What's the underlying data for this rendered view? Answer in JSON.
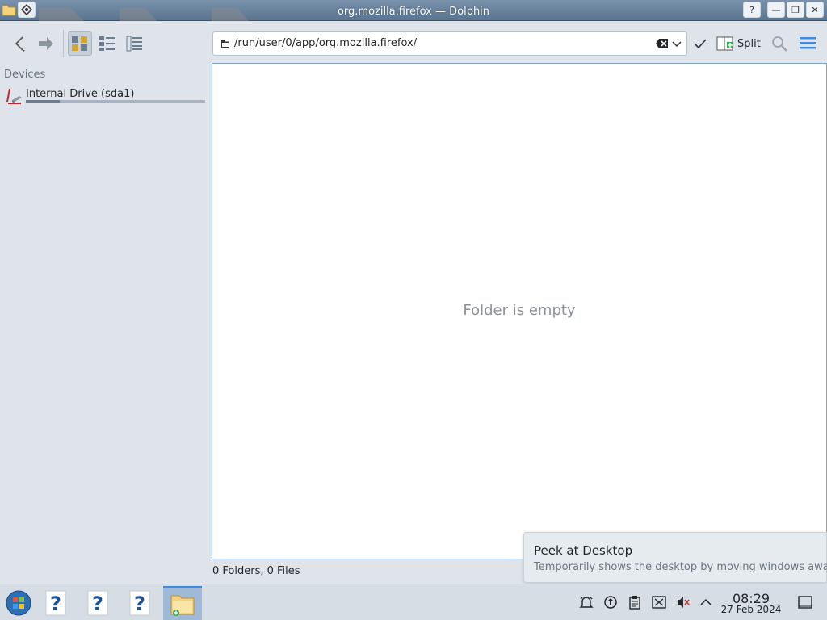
{
  "window": {
    "title": "org.mozilla.firefox — Dolphin",
    "buttons": {
      "help": "?",
      "minimize": "—",
      "maximize": "❐",
      "close": "✕"
    }
  },
  "toolbar": {
    "back_icon": "chevron-left-icon",
    "forward_icon": "arrow-right-icon",
    "view_modes": [
      "icons-view",
      "compact-view",
      "details-view"
    ],
    "active_view": "icons-view",
    "location_path": "/run/user/0/app/org.mozilla.firefox/",
    "split_label": "Split"
  },
  "places": {
    "section_label": "Devices",
    "items": [
      {
        "label": "Internal Drive (sda1)",
        "icon": "hard-drive-icon",
        "usage_fraction": 0.19
      }
    ]
  },
  "view": {
    "empty_message": "Folder is empty"
  },
  "status": {
    "summary": "0 Folders, 0 Files"
  },
  "tooltip": {
    "title": "Peek at Desktop",
    "subtitle": "Temporarily shows the desktop by moving windows away"
  },
  "taskbar": {
    "launchers": [
      "start-menu-icon",
      "unknown-app-icon",
      "unknown-app-icon",
      "unknown-app-icon",
      "dolphin-icon"
    ],
    "tray_icons": [
      "notifications-icon",
      "updates-icon",
      "clipboard-icon",
      "network-disconnected-icon",
      "volume-muted-icon",
      "expand-tray-icon"
    ],
    "clock_time": "08:29",
    "clock_date": "27 Feb 2024"
  },
  "colors": {
    "accent": "#3d8be0",
    "titlebar": "#5a7590",
    "view_border": "#85a5c5"
  }
}
